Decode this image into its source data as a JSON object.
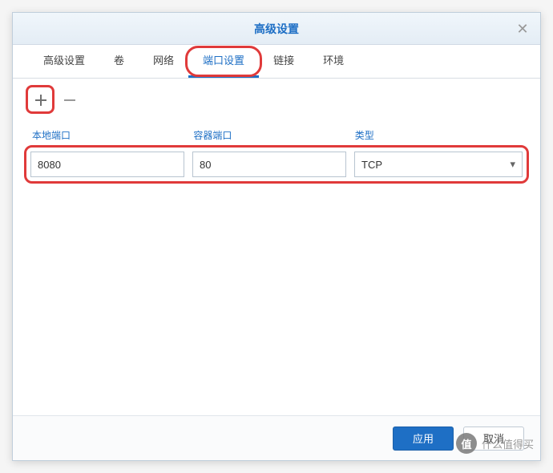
{
  "dialog": {
    "title": "高级设置"
  },
  "tabs": {
    "items": [
      {
        "label": "高级设置"
      },
      {
        "label": "卷"
      },
      {
        "label": "网络"
      },
      {
        "label": "端口设置"
      },
      {
        "label": "链接"
      },
      {
        "label": "环境"
      }
    ],
    "active_index": 3
  },
  "table": {
    "headers": {
      "local_port": "本地端口",
      "container_port": "容器端口",
      "type": "类型"
    },
    "rows": [
      {
        "local_port": "8080",
        "container_port": "80",
        "type": "TCP"
      }
    ]
  },
  "footer": {
    "apply": "应用",
    "cancel": "取消"
  },
  "watermark": {
    "badge": "值",
    "text": "什么值得买"
  }
}
